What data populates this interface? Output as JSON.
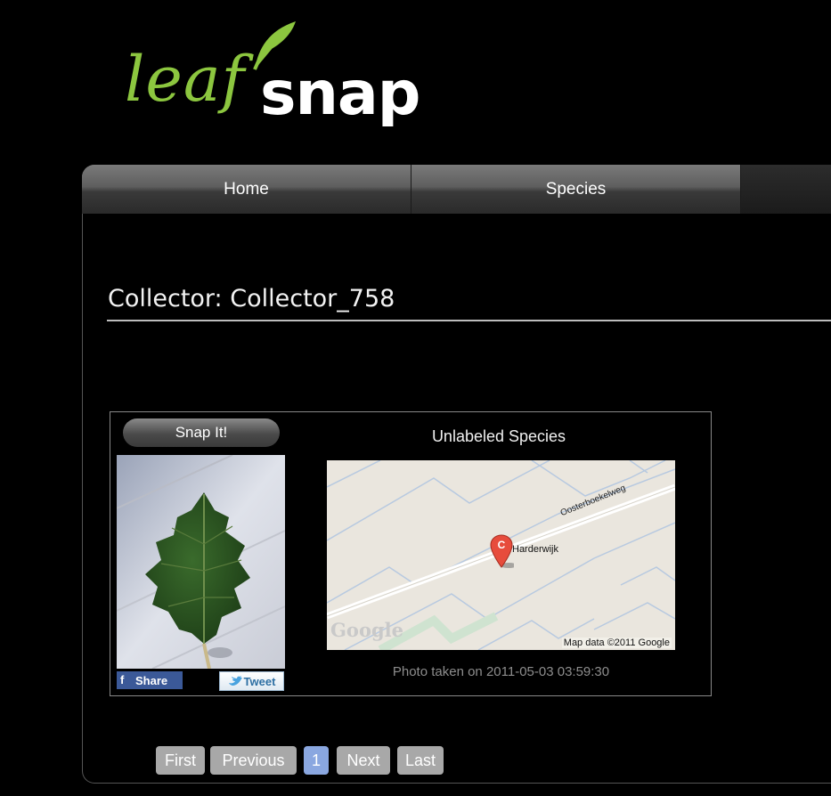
{
  "logo": {
    "part1": "leaf",
    "part2": "snap",
    "accent_color": "#8cc63f"
  },
  "nav": {
    "home": "Home",
    "species": "Species"
  },
  "page_title": "Collector: Collector_758",
  "card": {
    "snap_button": "Snap It!",
    "species_label": "Unlabeled Species",
    "share_label": "Share",
    "tweet_label": "Tweet",
    "photo_date": "Photo taken on 2011-05-03 03:59:30",
    "map": {
      "street": "Oosterboekelweg",
      "place": "Harderwijk",
      "marker_letter": "C",
      "google_logo": "Google",
      "credit": "Map data ©2011 Google"
    }
  },
  "pagination": {
    "first": "First",
    "previous": "Previous",
    "current": "1",
    "next": "Next",
    "last": "Last"
  }
}
